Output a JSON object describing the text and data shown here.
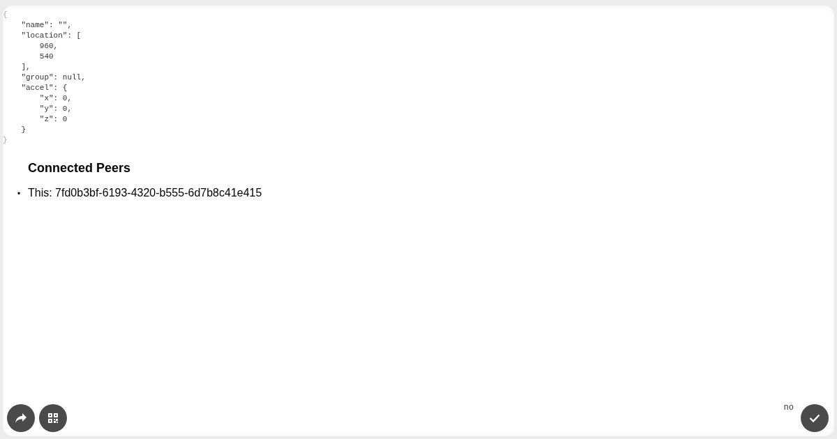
{
  "code_lines": [
    "{",
    "    \"name\": \"\",",
    "    \"location\": [",
    "        960,",
    "        540",
    "    ],",
    "    \"group\": null,",
    "    \"accel\": {",
    "        \"x\": 0,",
    "        \"y\": 0,",
    "        \"z\": 0",
    "    }",
    "}"
  ],
  "heading": "Connected Peers",
  "peers": [
    {
      "marker": "•",
      "label": "This: 7fd0b3bf-6193-4320-b555-6d7b8c41e415"
    }
  ],
  "status_text": "no"
}
